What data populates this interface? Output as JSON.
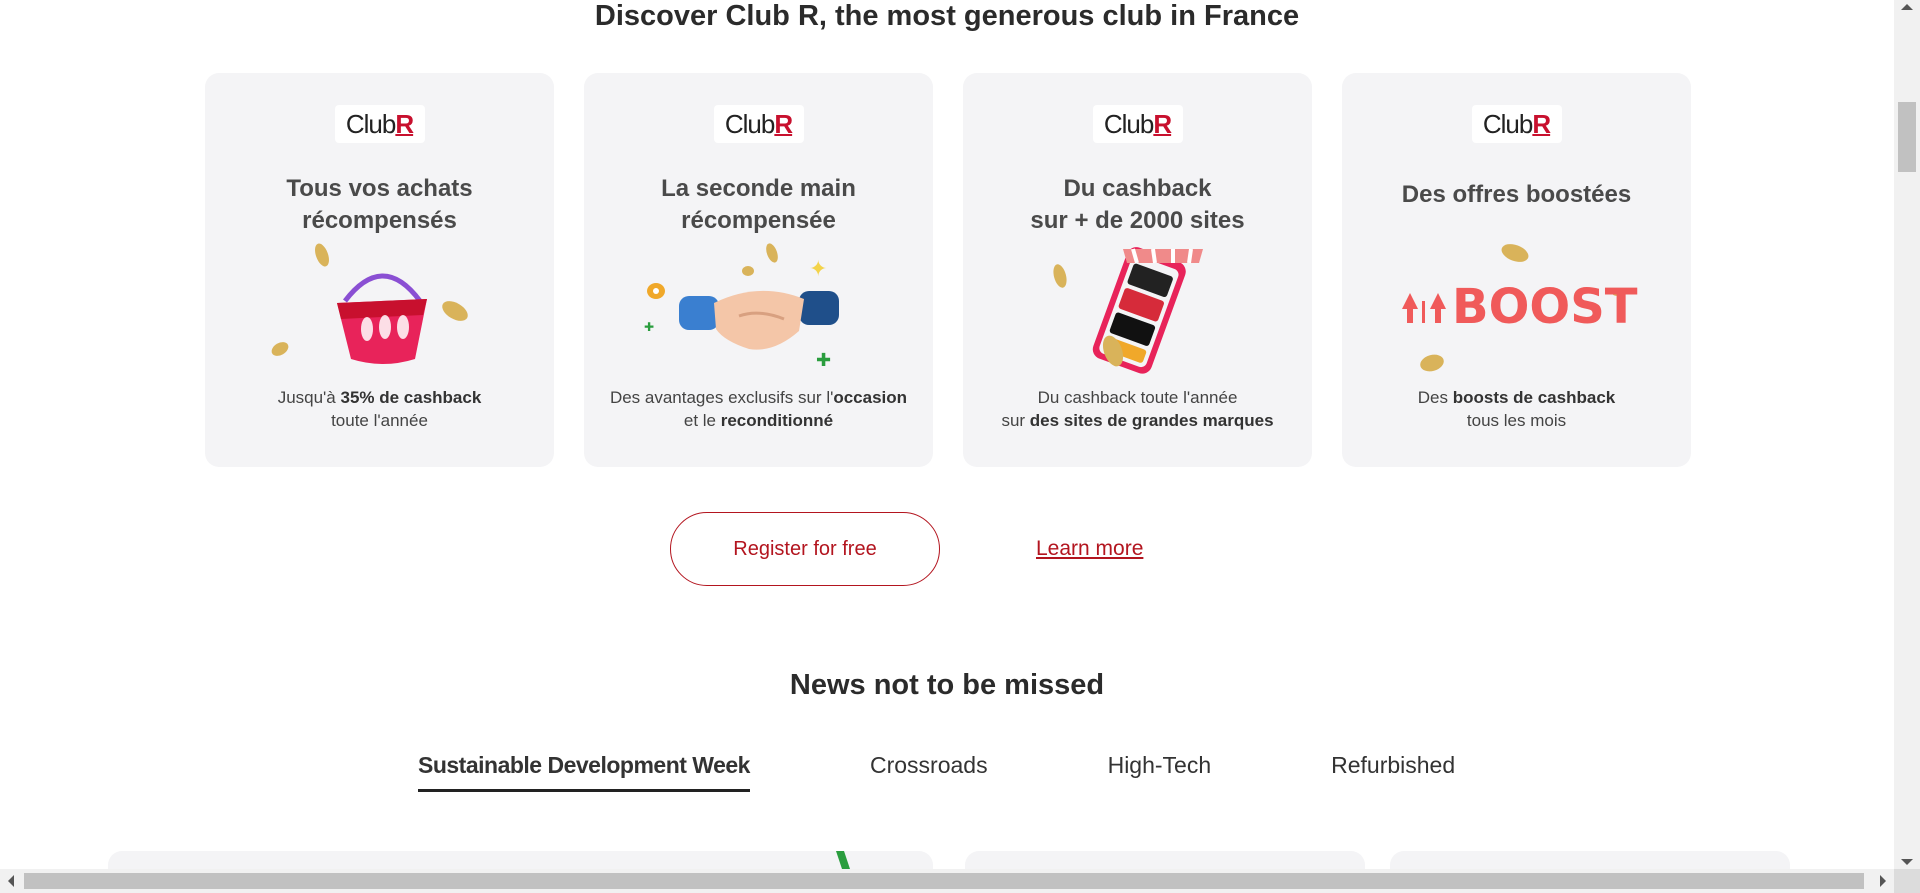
{
  "club": {
    "title": "Discover Club R, the most generous club in France",
    "logo_text": "Club",
    "logo_r": "R",
    "cards": [
      {
        "heading": "Tous vos achats récompensés",
        "desc_pre": "Jusqu'à ",
        "desc_bold": "35% de cashback",
        "desc_post": "toute l'année",
        "illustration": "basket-icon"
      },
      {
        "heading": "La seconde main récompensée",
        "desc_pre": "Des avantages exclusifs sur l'",
        "desc_bold": "occasion",
        "desc_mid": " et le ",
        "desc_bold2": "reconditionné",
        "illustration": "handshake-icon"
      },
      {
        "heading1": "Du cashback",
        "heading2": "sur + de 2000 sites",
        "desc_pre": "Du cashback toute l'année",
        "desc_pre2": "sur ",
        "desc_bold": "des sites de grandes marques",
        "illustration": "phone-shop-icon"
      },
      {
        "heading": "Des offres boostées",
        "boost_text": "BOOST",
        "desc_pre": "Des ",
        "desc_bold": "boosts de cashback",
        "desc_post": "tous les mois",
        "illustration": "boost-icon"
      }
    ],
    "register_label": "Register for free",
    "learn_more_label": "Learn more"
  },
  "news": {
    "title": "News not to be missed",
    "tabs": [
      "Sustainable Development Week",
      "Crossroads",
      "High-Tech",
      "Refurbished"
    ],
    "active_tab": 0
  },
  "colors": {
    "brand_red": "#b3151f",
    "card_bg": "#f4f4f6",
    "boost_red": "#f05a5a"
  }
}
